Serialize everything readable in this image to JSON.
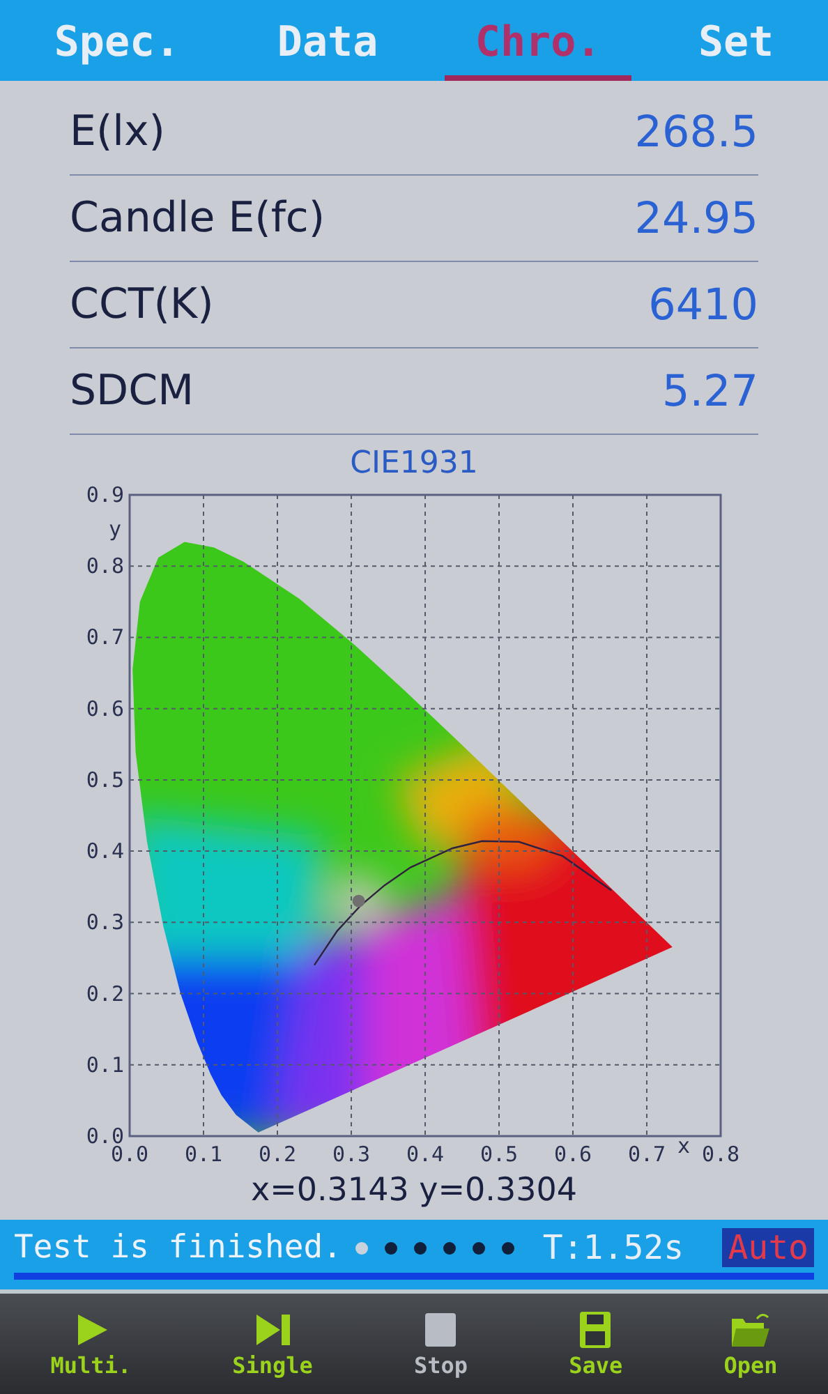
{
  "tabs": [
    {
      "label": "Spec.",
      "selected": false
    },
    {
      "label": "Data",
      "selected": false
    },
    {
      "label": "Chro.",
      "selected": true
    },
    {
      "label": "Set",
      "selected": false
    }
  ],
  "readings": [
    {
      "label": "E(lx)",
      "value": "268.5"
    },
    {
      "label": "Candle E(fc)",
      "value": "24.95"
    },
    {
      "label": "CCT(K)",
      "value": "6410"
    },
    {
      "label": "SDCM",
      "value": "5.27"
    }
  ],
  "chart": {
    "readout": "x=0.3143 y=0.3304",
    "chart_data": {
      "type": "scatter",
      "title": "CIE1931",
      "xlabel": "x",
      "ylabel": "y",
      "xlim": [
        0,
        0.8
      ],
      "ylim": [
        0,
        0.9
      ],
      "xticks": [
        {
          "value": 0,
          "label": "0.0"
        },
        {
          "value": 0.1,
          "label": "0.1"
        },
        {
          "value": 0.2,
          "label": "0.2"
        },
        {
          "value": 0.3,
          "label": "0.3"
        },
        {
          "value": 0.4,
          "label": "0.4"
        },
        {
          "value": 0.5,
          "label": "0.5"
        },
        {
          "value": 0.6,
          "label": "0.6"
        },
        {
          "value": 0.7,
          "label": "0.7"
        },
        {
          "value": 0.8,
          "label": "0.8"
        }
      ],
      "yticks": [
        {
          "value": 0,
          "label": "0.0"
        },
        {
          "value": 0.1,
          "label": "0.1"
        },
        {
          "value": 0.2,
          "label": "0.2"
        },
        {
          "value": 0.3,
          "label": "0.3"
        },
        {
          "value": 0.4,
          "label": "0.4"
        },
        {
          "value": 0.5,
          "label": "0.5"
        },
        {
          "value": 0.6,
          "label": "0.6"
        },
        {
          "value": 0.7,
          "label": "0.7"
        },
        {
          "value": 0.8,
          "label": "0.8"
        },
        {
          "value": 0.9,
          "label": "0.9"
        }
      ],
      "grid": true,
      "x": [
        0.31
      ],
      "series": [
        {
          "color": "#707070",
          "values": [
            0.33
          ]
        }
      ]
    }
  },
  "status": {
    "message": "Test is finished.",
    "progress_dots": [
      {
        "selected": true
      },
      {
        "selected": false
      },
      {
        "selected": false
      },
      {
        "selected": false
      },
      {
        "selected": false
      },
      {
        "selected": false
      }
    ],
    "time": "T:1.52s",
    "mode": "Auto"
  },
  "toolbar": [
    {
      "label": "Multi.",
      "kind": "play",
      "disabled": false
    },
    {
      "label": "Single",
      "kind": "step",
      "disabled": false
    },
    {
      "label": "Stop",
      "kind": "stop",
      "disabled": true
    },
    {
      "label": "Save",
      "kind": "save",
      "disabled": false
    },
    {
      "label": "Open",
      "kind": "open",
      "disabled": false
    }
  ]
}
